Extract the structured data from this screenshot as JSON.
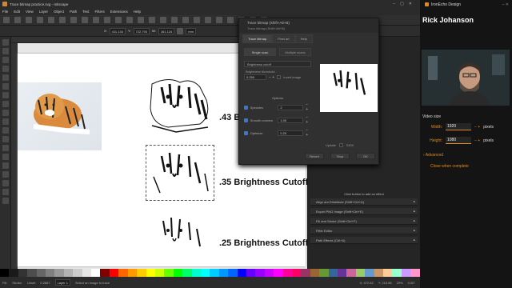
{
  "window": {
    "title": "Trace bitmap practice.svg - Inkscape"
  },
  "menu": [
    "File",
    "Edit",
    "View",
    "Layer",
    "Object",
    "Path",
    "Text",
    "Filters",
    "Extensions",
    "Help"
  ],
  "toolctl": {
    "x_label": "X:",
    "x": "411.134",
    "y_label": "Y:",
    "y": "722.793",
    "w_label": "W:",
    "w": "161.124",
    "unit": "mm"
  },
  "canvas": {
    "captions": [
      ".43 B",
      ".35 Brightness Cutoff",
      ".25 Brightness Cutoff"
    ]
  },
  "dialog": {
    "title": "Trace bitmap (Shift+Alt+B)",
    "subtitle": "Trace bitmap (Shift+Alt+B)",
    "tabs": [
      "Trace bitmap",
      "Pixel art",
      "Help"
    ],
    "modes": [
      "Single scan",
      "Multiple scans"
    ],
    "method": "Brightness cutoff",
    "threshold_label": "Brightness threshold",
    "threshold_value": "0.250",
    "invert_label": "Invert image",
    "options_label": "Options",
    "speckles_label": "Speckles",
    "speckles_value": "2",
    "smooth_label": "Smooth corners",
    "smooth_value": "1.00",
    "optimize_label": "Optimize",
    "optimize_value": "0.20",
    "update_label": "Update",
    "sioa_label": "SIOX",
    "buttons": [
      "Revert",
      "Stop",
      "OK"
    ]
  },
  "dock": {
    "hint": "Click button to add an effect",
    "panels": [
      "Align and Distribute (Shift+Ctrl+A)",
      "Export PNG Image (Shift+Ctrl+E)",
      "Fill and Stroke (Shift+Ctrl+F)",
      "Filter Editor",
      "Path Effects (Ctrl+&)"
    ]
  },
  "palette": [
    "#000000",
    "#1a1a1a",
    "#333333",
    "#4d4d4d",
    "#666666",
    "#808080",
    "#999999",
    "#b3b3b3",
    "#cccccc",
    "#e6e6e6",
    "#ffffff",
    "#800000",
    "#ff0000",
    "#ff6600",
    "#ff9900",
    "#ffcc00",
    "#ffff00",
    "#ccff00",
    "#66ff00",
    "#00ff00",
    "#00ff66",
    "#00ffcc",
    "#00ffff",
    "#00ccff",
    "#0099ff",
    "#0066ff",
    "#0000ff",
    "#6600ff",
    "#9900ff",
    "#cc00ff",
    "#ff00ff",
    "#ff0099",
    "#ff0066",
    "#993366",
    "#996633",
    "#669933",
    "#336699",
    "#663399",
    "#cc6699",
    "#99cc66",
    "#6699cc",
    "#cc9966",
    "#ffcc99",
    "#99ffcc",
    "#cc99ff",
    "#ff99cc"
  ],
  "status": {
    "fill": "Fill:",
    "stroke": "Stroke:",
    "stroke_val": "Unset",
    "stroke_w": "0.2667",
    "layer": "Layer 1",
    "message": "Select an image to trace",
    "x": "X: 472.62",
    "y": "Y: 215.56",
    "zoom": "29%",
    "rot": "0.00°"
  },
  "sidepanel": {
    "brand": "IronEcho Design",
    "user": "Rick Johanson",
    "video_size": "Video size",
    "width_label": "Width:",
    "width_value": "1920",
    "width_unit": "pixels",
    "height_label": "Height:",
    "height_value": "1080",
    "height_unit": "pixels",
    "advanced": "Advanced",
    "close_when": "Close when complete"
  }
}
